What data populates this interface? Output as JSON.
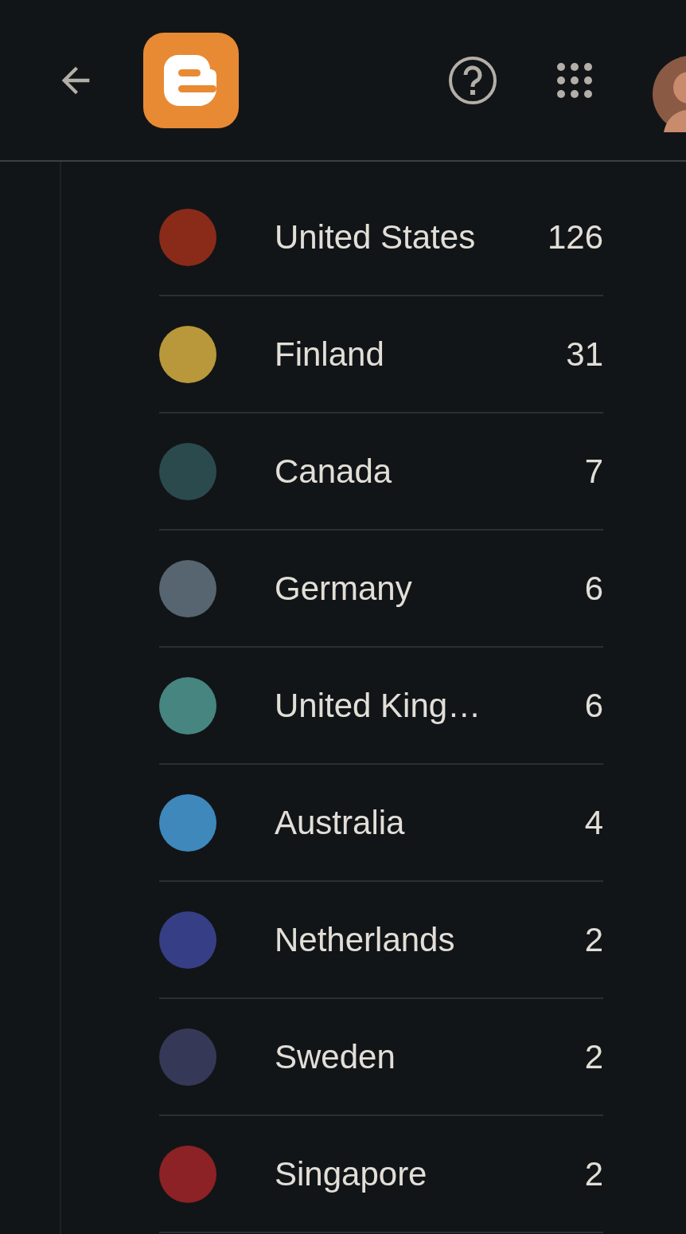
{
  "countries": [
    {
      "name": "United States",
      "count": "126",
      "color": "#8a2b1a"
    },
    {
      "name": "Finland",
      "count": "31",
      "color": "#b8983a"
    },
    {
      "name": "Canada",
      "count": "7",
      "color": "#2b4a4d"
    },
    {
      "name": "Germany",
      "count": "6",
      "color": "#56656f"
    },
    {
      "name": "United King…",
      "count": "6",
      "color": "#468580"
    },
    {
      "name": "Australia",
      "count": "4",
      "color": "#3f88bb"
    },
    {
      "name": "Netherlands",
      "count": "2",
      "color": "#363f85"
    },
    {
      "name": "Sweden",
      "count": "2",
      "color": "#363857"
    },
    {
      "name": "Singapore",
      "count": "2",
      "color": "#8c2226"
    }
  ]
}
